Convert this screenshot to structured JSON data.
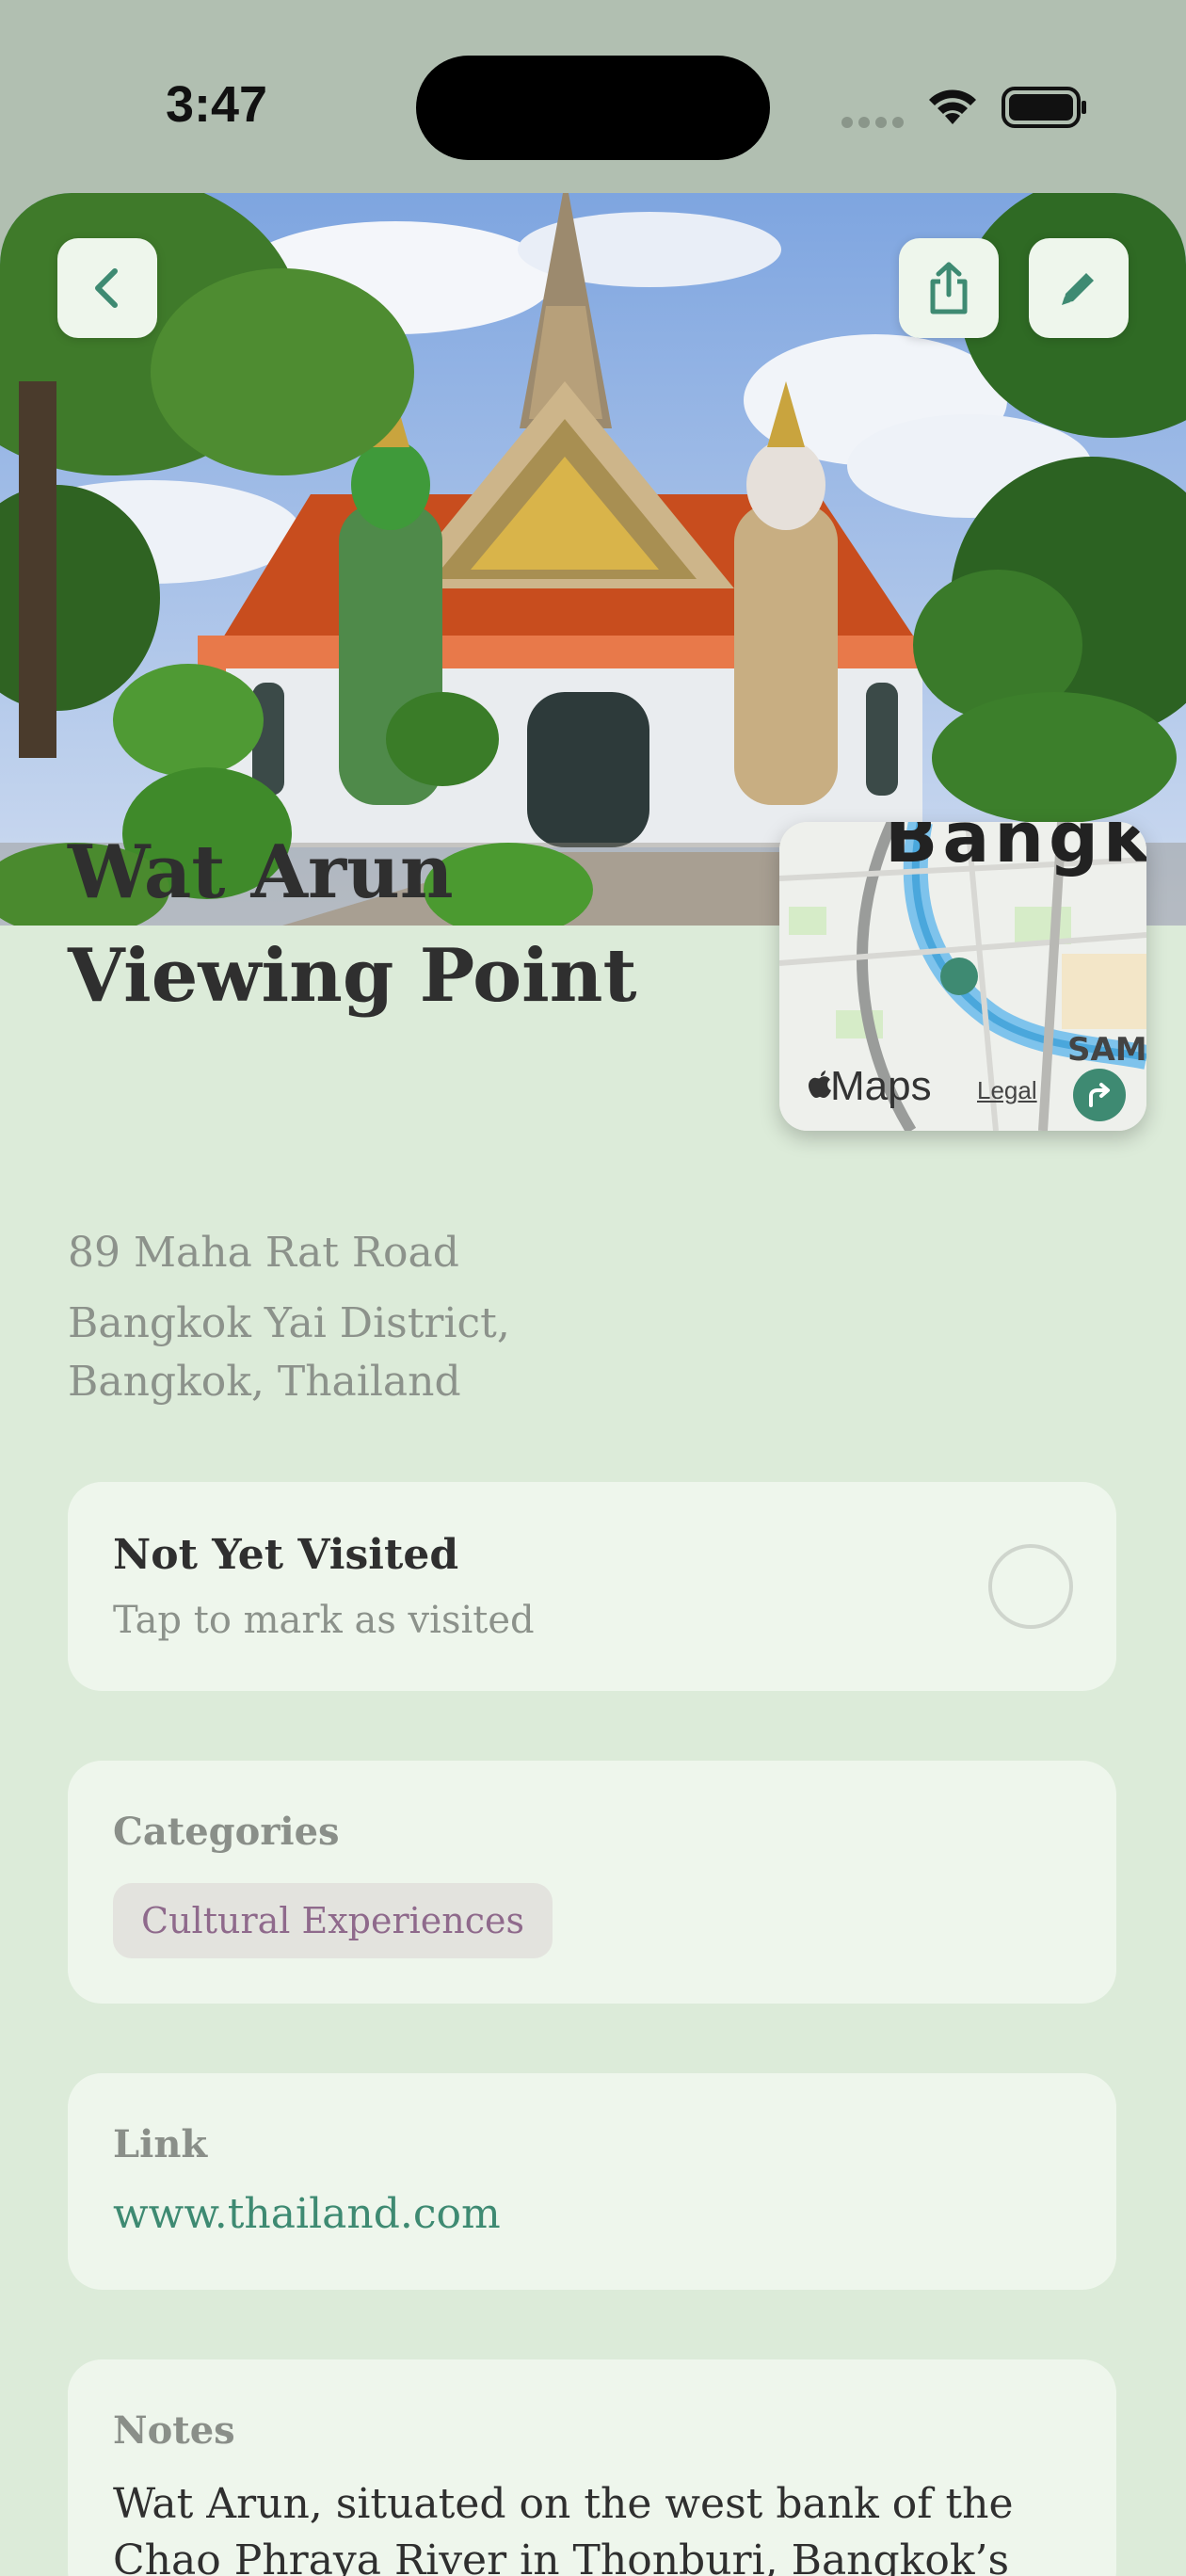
{
  "status_bar": {
    "time": "3:47"
  },
  "header": {
    "back_icon": "chevron-left-icon",
    "share_icon": "share-icon",
    "edit_icon": "pencil-icon",
    "accent_color": "#3e8a72"
  },
  "map": {
    "city_label": "Bangk",
    "area_label": "SAM",
    "maps_label": "Maps",
    "legal_label": "Legal"
  },
  "place": {
    "title": "Wat Arun Viewing Point",
    "address_line1": "89 Maha Rat Road",
    "address_line2": "Bangkok Yai District, Bangkok, Thailand"
  },
  "visit": {
    "title": "Not Yet Visited",
    "subtitle": "Tap to mark as visited"
  },
  "categories": {
    "label": "Categories",
    "items": [
      "Cultural Experiences"
    ]
  },
  "link": {
    "label": "Link",
    "value": "www.thailand.com"
  },
  "notes": {
    "label": "Notes",
    "text": "Wat Arun, situated on the west bank of the Chao Phraya River in Thonburi, Bangkok’s quaint"
  }
}
